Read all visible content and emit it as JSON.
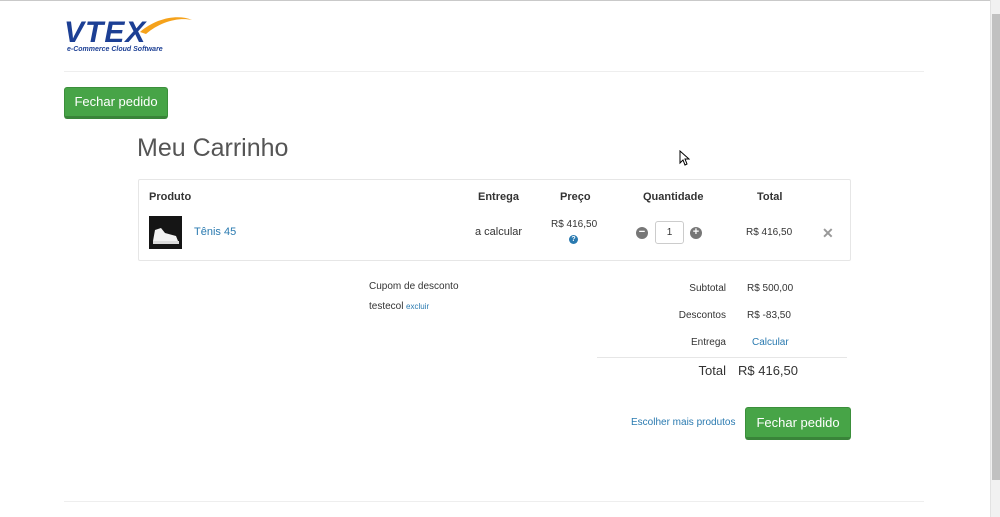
{
  "brand": {
    "logo_text": "VTEX",
    "tagline": "e-Commerce Cloud Software",
    "logo_color": "#1c3f94",
    "swoosh_color": "#f5a21b"
  },
  "header": {
    "checkout_button": "Fechar pedido"
  },
  "cart": {
    "title": "Meu Carrinho",
    "columns": {
      "product": "Produto",
      "delivery": "Entrega",
      "price": "Preço",
      "quantity": "Quantidade",
      "total": "Total"
    },
    "items": [
      {
        "name": "Tênis 45",
        "image": "white-sneaker-thumbnail",
        "delivery": "a calcular",
        "price": "R$ 416,50",
        "quantity": "1",
        "total": "R$ 416,50"
      }
    ]
  },
  "coupon": {
    "label": "Cupom de desconto",
    "code": "testecol",
    "remove_label": "excluir"
  },
  "summary": {
    "subtotal_label": "Subtotal",
    "subtotal_value": "R$ 500,00",
    "discounts_label": "Descontos",
    "discounts_value": "R$ -83,50",
    "shipping_label": "Entrega",
    "shipping_link": "Calcular",
    "total_label": "Total",
    "total_value": "R$ 416,50"
  },
  "footer_actions": {
    "more_products": "Escolher mais produtos",
    "checkout_button": "Fechar pedido"
  },
  "colors": {
    "accent_green": "#47a447",
    "link_blue": "#2a7ab0"
  }
}
